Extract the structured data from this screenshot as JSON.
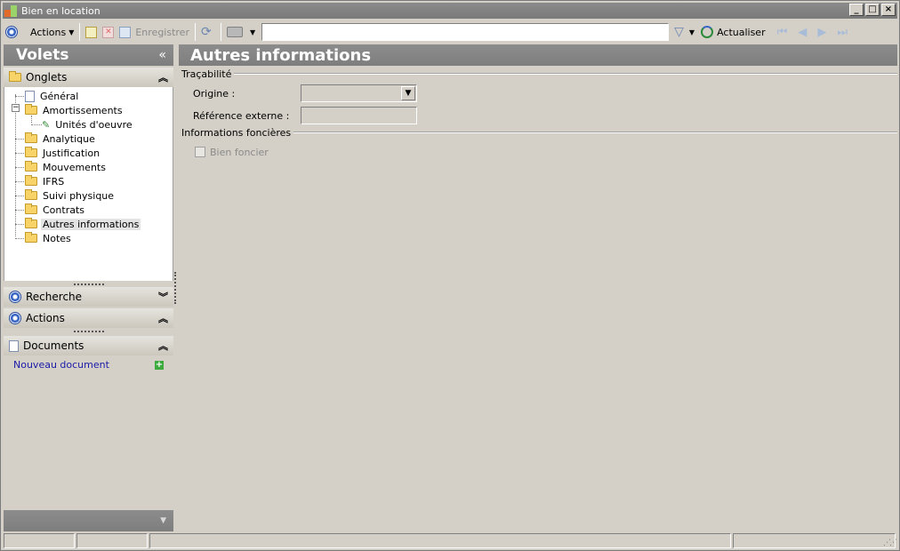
{
  "window": {
    "title": "Bien en location",
    "controls": [
      "minimize",
      "maximize",
      "close"
    ]
  },
  "toolbar": {
    "actions_label": "Actions",
    "save_label": "Enregistrer",
    "refresh_label": "Actualiser",
    "search_value": ""
  },
  "left_panel": {
    "title": "Volets",
    "collapse_glyph": "«",
    "onglets": {
      "label": "Onglets",
      "items": [
        {
          "label": "Général",
          "level": 1,
          "icon": "document-gear-icon"
        },
        {
          "label": "Amortissements",
          "level": 1,
          "icon": "folder-icon",
          "expanded": true
        },
        {
          "label": "Unités d'oeuvre",
          "level": 2,
          "icon": "tool-icon"
        },
        {
          "label": "Analytique",
          "level": 1,
          "icon": "folder-icon"
        },
        {
          "label": "Justification",
          "level": 1,
          "icon": "folder-icon"
        },
        {
          "label": "Mouvements",
          "level": 1,
          "icon": "folder-icon"
        },
        {
          "label": "IFRS",
          "level": 1,
          "icon": "folder-icon"
        },
        {
          "label": "Suivi physique",
          "level": 1,
          "icon": "folder-icon"
        },
        {
          "label": "Contrats",
          "level": 1,
          "icon": "folder-icon"
        },
        {
          "label": "Autres informations",
          "level": 1,
          "icon": "folder-open-icon",
          "selected": true
        },
        {
          "label": "Notes",
          "level": 1,
          "icon": "folder-icon"
        }
      ]
    },
    "recherche_label": "Recherche",
    "actions_label": "Actions",
    "documents": {
      "label": "Documents",
      "new_document_label": "Nouveau document"
    }
  },
  "main": {
    "title": "Autres informations",
    "tracabilite": {
      "label": "Traçabilité",
      "origine_label": "Origine :",
      "origine_value": "",
      "reference_label": "Référence externe :",
      "reference_value": ""
    },
    "foncieres": {
      "label": "Informations foncières",
      "bien_foncier_label": "Bien foncier",
      "bien_foncier_checked": false
    }
  },
  "colors": {
    "header_gray": "#858585",
    "face": "#d4d0c8",
    "link_blue": "#1a1aa8"
  }
}
